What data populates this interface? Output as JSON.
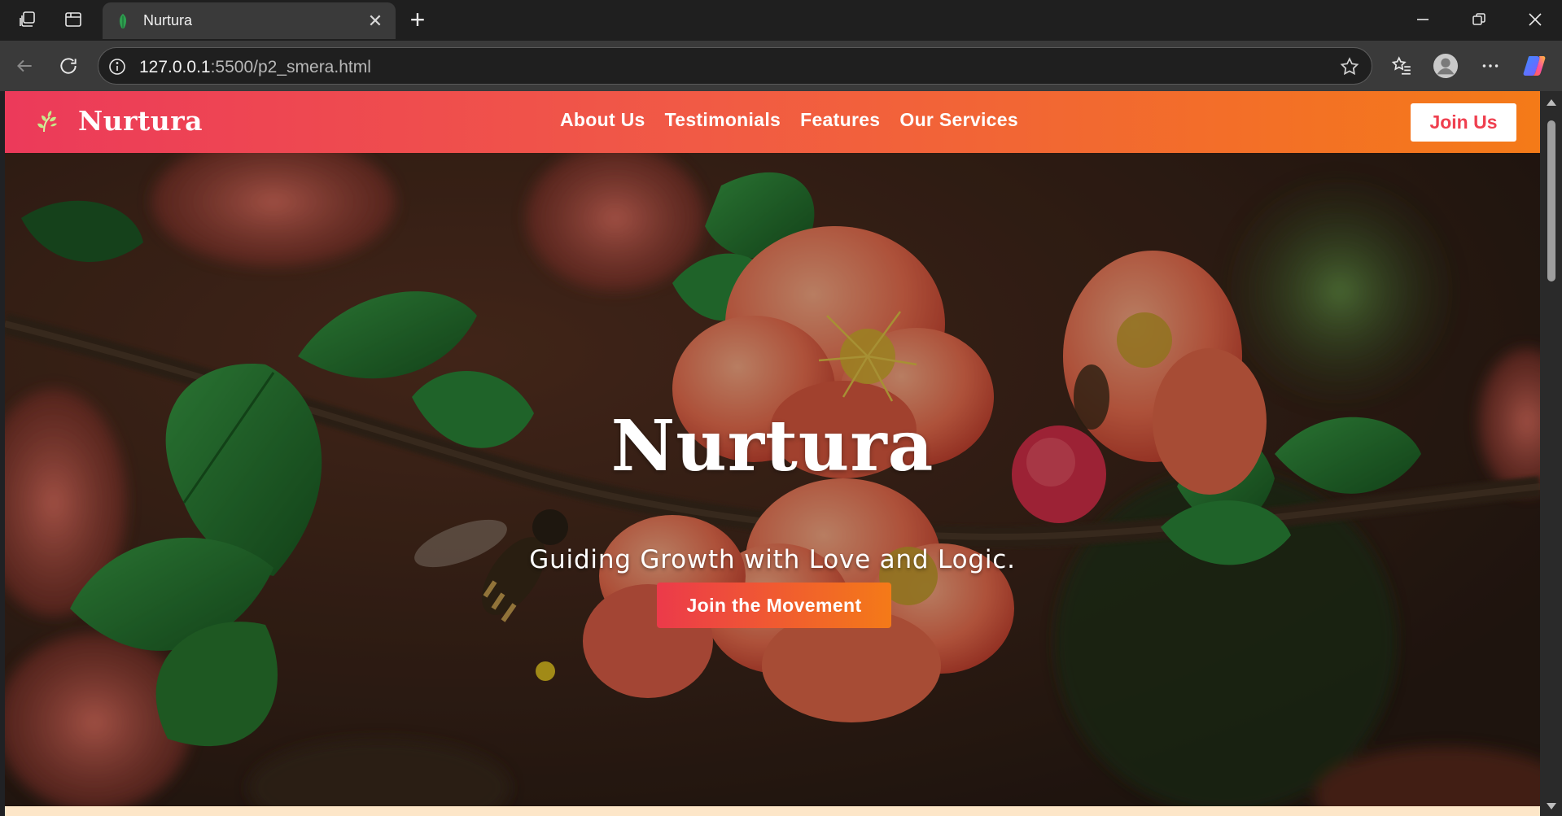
{
  "browser": {
    "tab_title": "Nurtura",
    "new_tab": "+",
    "close": "✕",
    "url_host": "127.0.0.1",
    "url_rest": ":5500/p2_smera.html"
  },
  "site": {
    "brand": "Nurtura",
    "nav": [
      "About Us",
      "Testimonials",
      "Features",
      "Our Services"
    ],
    "join_label": "Join Us",
    "colors": {
      "gradient_start": "#ec3a5a",
      "gradient_end": "#f47a18"
    }
  },
  "hero": {
    "title": "Nurtura",
    "subtitle": "Guiding Growth with Love and Logic.",
    "cta": "Join the Movement"
  },
  "icons": [
    "workspaces-icon",
    "tab-actions-icon",
    "leaf-favicon-icon",
    "back-icon",
    "reload-icon",
    "info-icon",
    "star-icon",
    "favorites-icon",
    "profile-icon",
    "more-icon",
    "copilot-icon",
    "minimize-icon",
    "restore-icon",
    "close-window-icon",
    "sprout-logo-icon"
  ]
}
